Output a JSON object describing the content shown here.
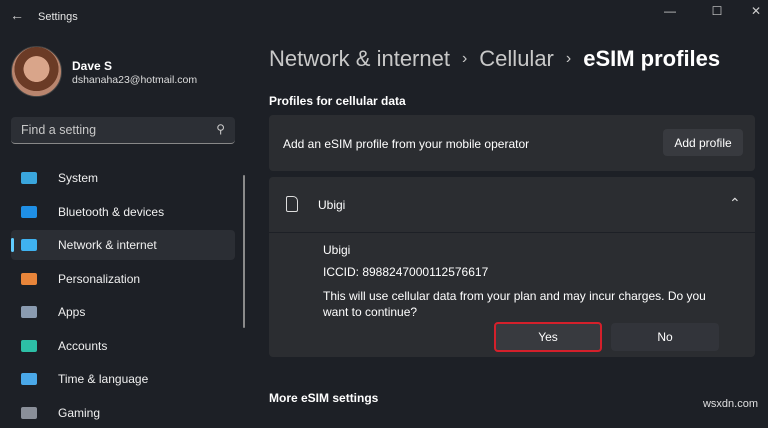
{
  "window": {
    "title": "Settings",
    "minimize": "—",
    "maximize": "☐",
    "close": "✕"
  },
  "user": {
    "name": "Dave S",
    "email": "dshanaha23@hotmail.com"
  },
  "search": {
    "placeholder": "Find a setting"
  },
  "nav": [
    {
      "label": "System",
      "color": "#3aa6dd"
    },
    {
      "label": "Bluetooth & devices",
      "color": "#1f8fe5"
    },
    {
      "label": "Network & internet",
      "color": "#3fb2f0"
    },
    {
      "label": "Personalization",
      "color": "#e8853a"
    },
    {
      "label": "Apps",
      "color": "#8a9bb0"
    },
    {
      "label": "Accounts",
      "color": "#2dbfa6"
    },
    {
      "label": "Time & language",
      "color": "#4aa8e8"
    },
    {
      "label": "Gaming",
      "color": "#8a8f99"
    }
  ],
  "breadcrumb": [
    "Network & internet",
    "Cellular",
    "eSIM profiles"
  ],
  "section_title": "Profiles for cellular data",
  "add_card": {
    "text": "Add an eSIM profile from your mobile operator",
    "button": "Add profile"
  },
  "profile": {
    "name": "Ubigi",
    "detail_name": "Ubigi",
    "iccid": "ICCID: 8988247000112576617",
    "message": "This will use cellular data from your plan and may incur charges. Do you want to continue?",
    "yes": "Yes",
    "no": "No"
  },
  "more_section": "More eSIM settings",
  "watermark": "wsxdn.com"
}
